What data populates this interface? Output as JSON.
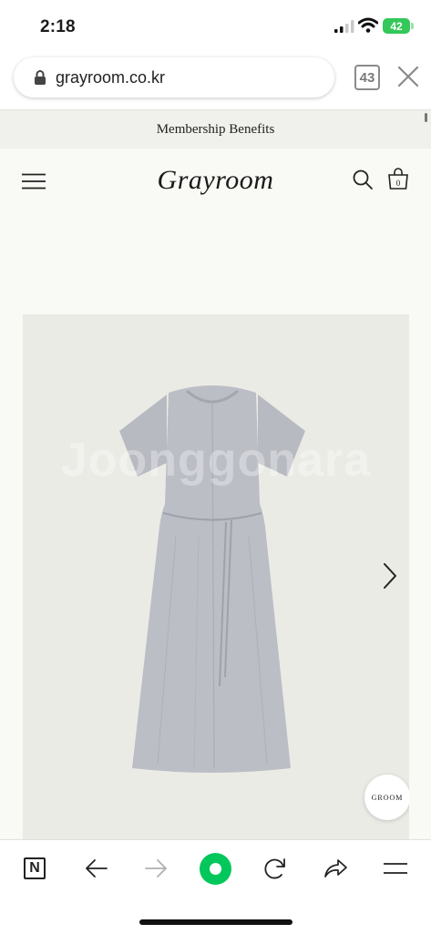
{
  "status_bar": {
    "time": "2:18",
    "battery": "42"
  },
  "browser": {
    "url": "grayroom.co.kr",
    "tab_count": "43"
  },
  "banner": {
    "text": "Membership Benefits"
  },
  "header": {
    "logo": "Grayroom"
  },
  "product": {
    "watermark": "Joonggonara",
    "badge": "GROOM"
  },
  "colors": {
    "home_button": "#03c75a",
    "battery": "#34c759"
  }
}
